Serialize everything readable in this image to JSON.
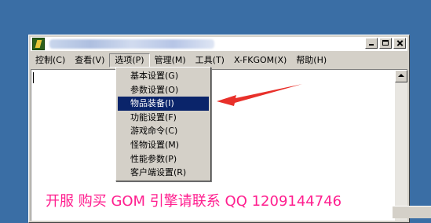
{
  "window": {
    "title_redacted": true
  },
  "menubar": {
    "items": [
      {
        "label": "控制(C)"
      },
      {
        "label": "查看(V)"
      },
      {
        "label": "选项(P)",
        "active": true
      },
      {
        "label": "管理(M)"
      },
      {
        "label": "工具(T)"
      },
      {
        "label": "X-FKGOM(X)"
      },
      {
        "label": "帮助(H)"
      }
    ]
  },
  "dropdown": {
    "items": [
      {
        "label": "基本设置(G)"
      },
      {
        "label": "参数设置(O)"
      },
      {
        "label": "物品装备(I)",
        "selected": true
      },
      {
        "label": "功能设置(F)"
      },
      {
        "label": "游戏命令(C)"
      },
      {
        "label": "怪物设置(M)"
      },
      {
        "label": "性能参数(P)"
      },
      {
        "label": "客户端设置(R)"
      }
    ]
  },
  "promo_text": "开服 购买 GOM 引擎请联系 QQ 1209144746",
  "colors": {
    "desktop": "#3a6ea5",
    "selection": "#0a246a",
    "promo": "#ff1f8f",
    "arrow": "#e8302a"
  },
  "icons": [
    "app-icon",
    "minimize-icon",
    "maximize-icon",
    "close-icon",
    "scroll-up-arrow-icon",
    "pointer-arrow-annotation"
  ]
}
